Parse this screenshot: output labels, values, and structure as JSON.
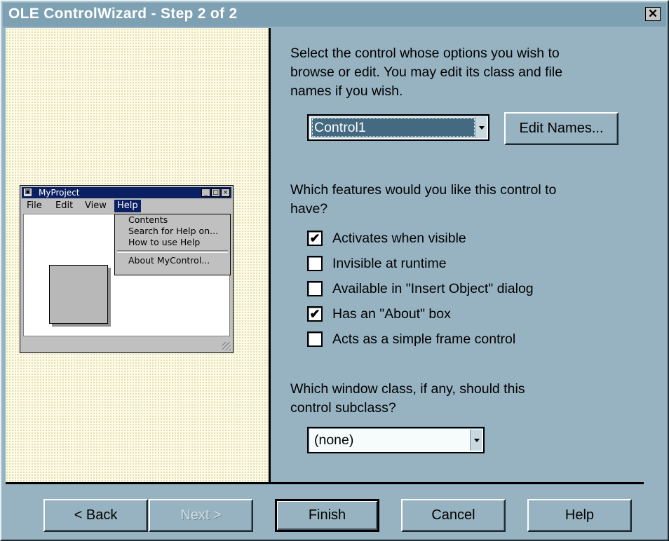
{
  "window": {
    "title": "OLE ControlWizard - Step 2 of 2",
    "close_glyph": "✕"
  },
  "preview": {
    "title": "MyProject",
    "menu": [
      "File",
      "Edit",
      "View",
      "Help"
    ],
    "dropdown": [
      "Contents",
      "Search for Help on...",
      "How to use Help",
      "About MyControl..."
    ]
  },
  "select_control": {
    "prompt_lines": [
      "Select the control whose options you wish to",
      "browse or edit.  You may edit its class and file",
      "names if you wish."
    ],
    "combo_value": "Control1",
    "edit_names_label": "Edit Names..."
  },
  "features": {
    "prompt_lines": [
      "Which features would you like this control to",
      "have?"
    ],
    "options": [
      {
        "label": "Activates when visible",
        "checked": true
      },
      {
        "label": "Invisible at runtime",
        "checked": false
      },
      {
        "label": "Available in \"Insert Object\" dialog",
        "checked": false
      },
      {
        "label": "Has an \"About\" box",
        "checked": true
      },
      {
        "label": "Acts as a simple frame control",
        "checked": false
      }
    ]
  },
  "subclass": {
    "prompt_lines": [
      "Which window class, if any, should this",
      "control subclass?"
    ],
    "combo_value": "(none)"
  },
  "buttons": {
    "back": "< Back",
    "next": "Next >",
    "finish": "Finish",
    "cancel": "Cancel",
    "help": "Help"
  }
}
